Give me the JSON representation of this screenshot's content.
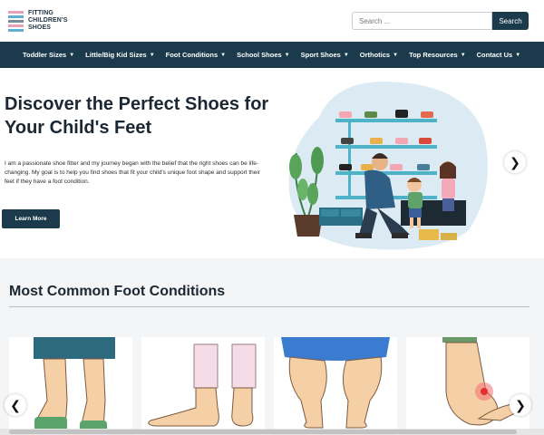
{
  "logo": {
    "lines": [
      "FITTING",
      "CHILDREN'S",
      "SHOES"
    ]
  },
  "search": {
    "placeholder": "Search ...",
    "button_label": "Search"
  },
  "nav": {
    "items": [
      {
        "label": "Toddler Sizes"
      },
      {
        "label": "Little/Big Kid Sizes"
      },
      {
        "label": "Foot Conditions"
      },
      {
        "label": "School Shoes"
      },
      {
        "label": "Sport Shoes"
      },
      {
        "label": "Orthotics"
      },
      {
        "label": "Top Resources"
      },
      {
        "label": "Contact Us"
      }
    ],
    "chevron_icon": "chevron-down-icon"
  },
  "hero": {
    "title": "Discover the Perfect Shoes for Your Child's Feet",
    "body": "I am a passionate shoe fitter and my journey began with the belief that the right shoes can be life-changing. My goal is to help you find shoes that fit your child's unique foot shape and support their feet if they have a foot condition.",
    "cta_label": "Learn More",
    "next_icon": "chevron-right-icon"
  },
  "conditions": {
    "title": "Most Common Foot Conditions",
    "prev_icon": "chevron-left-icon",
    "next_icon": "chevron-right-icon"
  },
  "colors": {
    "brand_dark": "#1b3a4b",
    "accent_teal": "#4fb3c8",
    "skin": "#f5cfa6"
  }
}
